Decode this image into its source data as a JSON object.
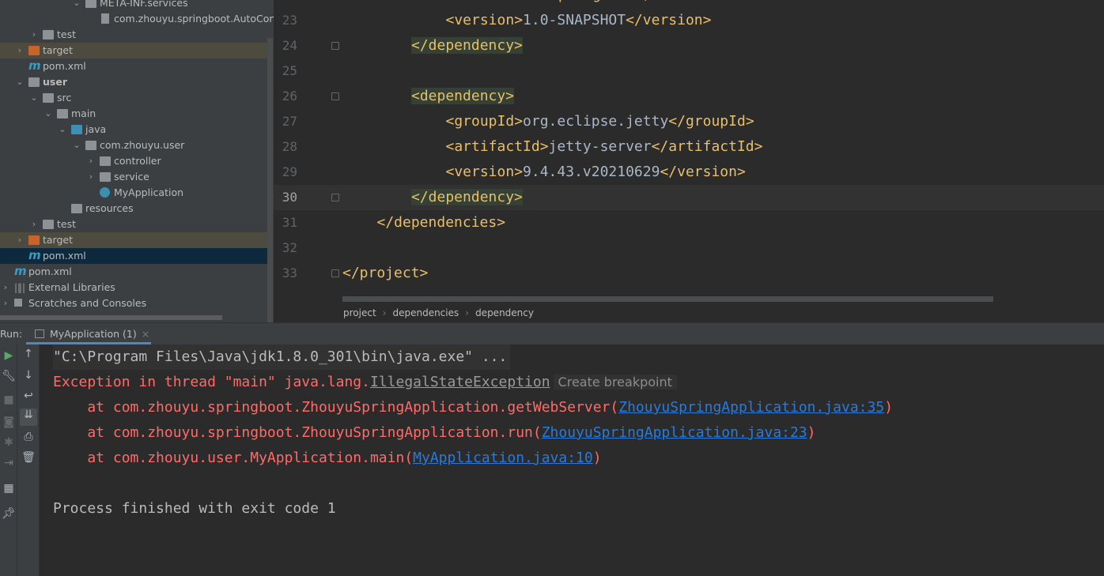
{
  "project_tree": {
    "items": [
      {
        "label": "META-INF.services",
        "type": "folder",
        "expanded": true
      },
      {
        "label": "com.zhouyu.springboot.AutoConfig",
        "type": "file"
      },
      {
        "label": "test",
        "type": "folder",
        "expanded": false
      },
      {
        "label": "target",
        "type": "excluded-folder",
        "expanded": false
      },
      {
        "label": "pom.xml",
        "type": "maven"
      },
      {
        "label": "user",
        "type": "module",
        "expanded": true
      },
      {
        "label": "src",
        "type": "folder",
        "expanded": true
      },
      {
        "label": "main",
        "type": "folder",
        "expanded": true
      },
      {
        "label": "java",
        "type": "source-folder",
        "expanded": true
      },
      {
        "label": "com.zhouyu.user",
        "type": "package",
        "expanded": true
      },
      {
        "label": "controller",
        "type": "package",
        "expanded": false
      },
      {
        "label": "service",
        "type": "package",
        "expanded": false
      },
      {
        "label": "MyApplication",
        "type": "class"
      },
      {
        "label": "resources",
        "type": "resources-folder"
      },
      {
        "label": "test",
        "type": "folder",
        "expanded": false
      },
      {
        "label": "target",
        "type": "excluded-folder",
        "expanded": false
      },
      {
        "label": "pom.xml",
        "type": "maven",
        "selected": true
      },
      {
        "label": "pom.xml",
        "type": "maven"
      },
      {
        "label": "External Libraries",
        "type": "libraries",
        "expanded": false
      },
      {
        "label": "Scratches and Consoles",
        "type": "scratches",
        "expanded": false
      }
    ]
  },
  "editor": {
    "current_line": 30,
    "lines": [
      {
        "n": "23",
        "text": "<version>1.0-SNAPSHOT</version>"
      },
      {
        "n": "24",
        "text": "</dependency>"
      },
      {
        "n": "25",
        "text": ""
      },
      {
        "n": "26",
        "text": "<dependency>"
      },
      {
        "n": "27",
        "text": "<groupId>org.eclipse.jetty</groupId>"
      },
      {
        "n": "28",
        "text": "<artifactId>jetty-server</artifactId>"
      },
      {
        "n": "29",
        "text": "<version>9.4.43.v20210629</version>"
      },
      {
        "n": "30",
        "text": "</dependency>"
      },
      {
        "n": "31",
        "text": "</dependencies>"
      },
      {
        "n": "32",
        "text": ""
      },
      {
        "n": "33",
        "text": "</project>"
      }
    ],
    "breadcrumbs": [
      "project",
      "dependencies",
      "dependency"
    ]
  },
  "run": {
    "label": "Run:",
    "tab": "MyApplication (1)",
    "console": {
      "command": "\"C:\\Program Files\\Java\\jdk1.8.0_301\\bin\\java.exe\" ...",
      "exception_prefix": "Exception in thread \"main\" java.lang.",
      "exception_class": "IllegalStateException",
      "create_breakpoint": "Create breakpoint",
      "stack": [
        {
          "text": "    at com.zhouyu.springboot.ZhouyuSpringApplication.getWebServer(",
          "link": "ZhouyuSpringApplication.java:35",
          "end": ")"
        },
        {
          "text": "    at com.zhouyu.springboot.ZhouyuSpringApplication.run(",
          "link": "ZhouyuSpringApplication.java:23",
          "end": ")"
        },
        {
          "text": "    at com.zhouyu.user.MyApplication.main(",
          "link": "MyApplication.java:10",
          "end": ")"
        }
      ],
      "exit": "Process finished with exit code 1"
    }
  }
}
